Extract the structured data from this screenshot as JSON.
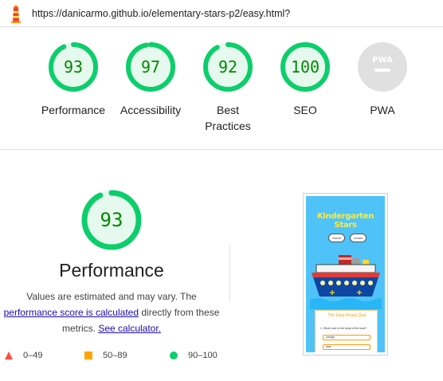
{
  "header": {
    "url": "https://danicarmo.github.io/elementary-stars-p2/easy.html?"
  },
  "categories": [
    {
      "key": "performance",
      "label": "Performance",
      "score": 93,
      "display": "93"
    },
    {
      "key": "accessibility",
      "label": "Accessibility",
      "score": 97,
      "display": "97"
    },
    {
      "key": "best-practices",
      "label": "Best\nPractices",
      "score": 92,
      "display": "92"
    },
    {
      "key": "seo",
      "label": "SEO",
      "score": 100,
      "display": "100"
    },
    {
      "key": "pwa",
      "label": "PWA",
      "score": null,
      "display": "PWA"
    }
  ],
  "performance": {
    "score": 93,
    "display": "93",
    "title": "Performance",
    "desc_prefix": "Values are estimated and may vary. The",
    "score_link": "performance score is calculated",
    "desc_middle": "directly from these metrics.",
    "calc_link": "See calculator."
  },
  "legend": {
    "fail": "0–49",
    "average": "50–89",
    "pass": "90–100"
  },
  "screenshot": {
    "app_title": "Kindergarten Stars",
    "home_button": "Home",
    "levels_button": "Levels",
    "quiz_title": "The Easy-Peasy Quiz",
    "question": "1. What color is the body of the boat?",
    "option_1": "orange",
    "option_2": "blue"
  },
  "colors": {
    "pass": "#0cce6b",
    "pass_text": "#008800",
    "pass_fill": "#e6f9ee",
    "average": "#ffa400",
    "fail": "#ff4e42",
    "pwa_grey": "#bdbdbd",
    "link": "#1a0dab"
  }
}
